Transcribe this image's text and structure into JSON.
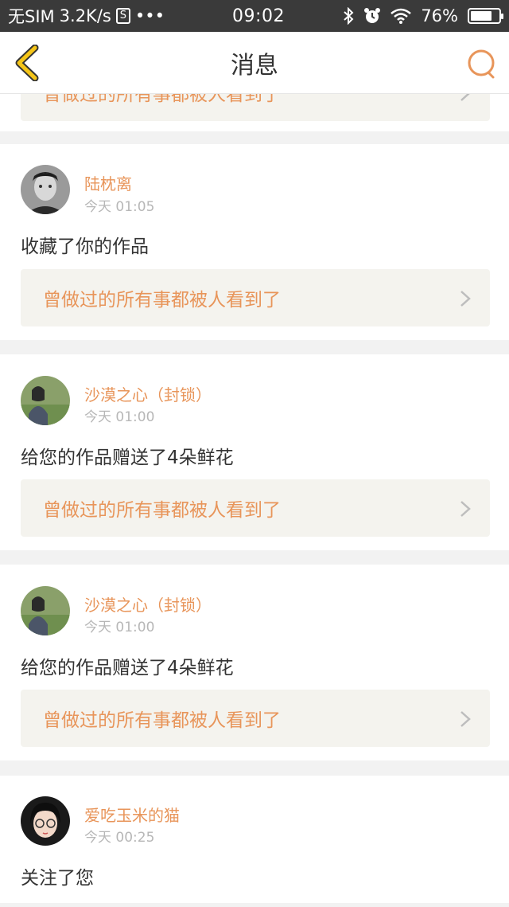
{
  "status": {
    "carrier": "无SIM",
    "speed": "3.2K/s",
    "sim_icon": "S",
    "dots": "•••",
    "time": "09:02",
    "battery": "76%",
    "battery_level": 0.76
  },
  "header": {
    "title": "消息"
  },
  "feed": {
    "partial": {
      "work_title": "曾做过的所有事都被人看到了"
    },
    "items": [
      {
        "user": "陆枕离",
        "time": "今天 01:05",
        "action": "收藏了你的作品",
        "work_title": "曾做过的所有事都被人看到了"
      },
      {
        "user": "沙漠之心（封锁）",
        "time": "今天 01:00",
        "action": "给您的作品赠送了4朵鲜花",
        "work_title": "曾做过的所有事都被人看到了"
      },
      {
        "user": "沙漠之心（封锁）",
        "time": "今天 01:00",
        "action": "给您的作品赠送了4朵鲜花",
        "work_title": "曾做过的所有事都被人看到了"
      },
      {
        "user": "爱吃玉米的猫",
        "time": "今天 00:25",
        "action": "关注了您"
      }
    ]
  },
  "colors": {
    "accent": "#e8955a",
    "back_arrow": "#f5c518",
    "status_bg": "#3a3a3a",
    "divider": "#f2f2f2"
  }
}
